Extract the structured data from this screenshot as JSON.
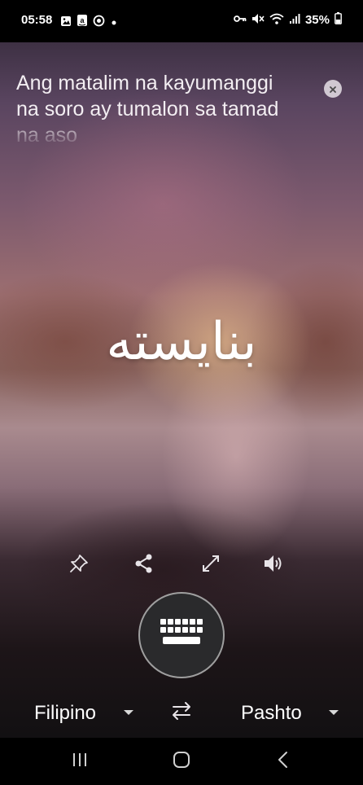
{
  "status_bar": {
    "time": "05:58",
    "battery": "35%",
    "left_icons": [
      "image-icon",
      "amazon-icon",
      "target-icon",
      "dot-icon"
    ],
    "right_icons": [
      "key-icon",
      "mute-icon",
      "wifi-icon",
      "signal-icon",
      "battery-icon"
    ]
  },
  "translation": {
    "source_text": "Ang matalim na kayumanggi na soro ay tumalon sa tamad na aso",
    "translated_text": "بنایسته"
  },
  "actions": [
    {
      "name": "pin-icon"
    },
    {
      "name": "share-icon"
    },
    {
      "name": "fullscreen-icon"
    },
    {
      "name": "speaker-icon"
    }
  ],
  "keyboard_button": {
    "icon": "keyboard-icon"
  },
  "languages": {
    "source": "Filipino",
    "target": "Pashto",
    "swap_icon": "swap-icon"
  },
  "nav_bar": {
    "buttons": [
      "recent-apps-icon",
      "home-icon",
      "back-icon"
    ]
  },
  "colors": {
    "status_bg": "#000000",
    "text": "#ffffff",
    "keyboard_bg": "#2a2a2c"
  }
}
